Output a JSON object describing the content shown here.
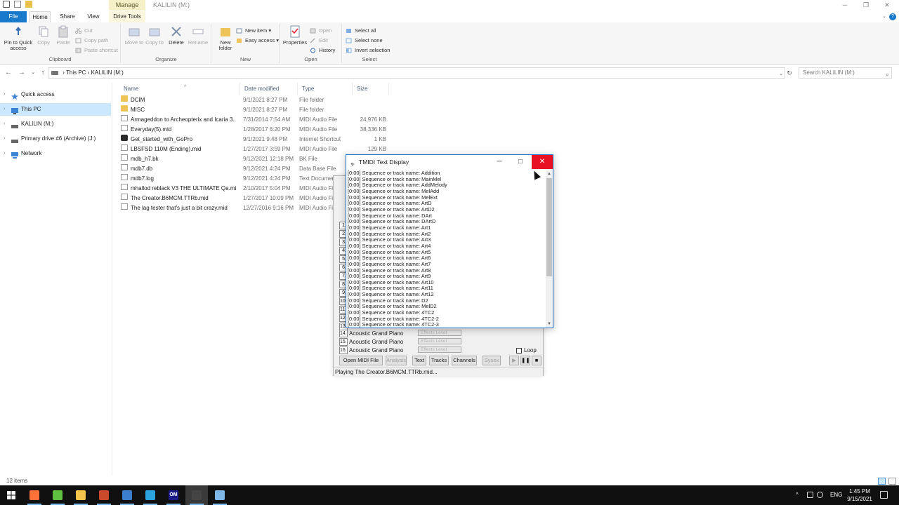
{
  "explorer": {
    "window_title": "KALILIN (M:)",
    "context_tab": "Manage",
    "tabs": [
      "File",
      "Home",
      "Share",
      "View",
      "Drive Tools"
    ],
    "ribbon": {
      "clipboard": {
        "label": "Clipboard",
        "pin": "Pin to Quick access",
        "copy": "Copy",
        "paste": "Paste",
        "cut": "Cut",
        "copy_path": "Copy path",
        "paste_shortcut": "Paste shortcut"
      },
      "organize": {
        "label": "Organize",
        "move_to": "Move to",
        "copy_to": "Copy to",
        "delete": "Delete",
        "rename": "Rename"
      },
      "new": {
        "label": "New",
        "new_folder": "New folder",
        "new_item": "New item",
        "easy_access": "Easy access"
      },
      "open": {
        "label": "Open",
        "properties": "Properties",
        "open": "Open",
        "edit": "Edit",
        "history": "History"
      },
      "select": {
        "label": "Select",
        "select_all": "Select all",
        "select_none": "Select none",
        "invert": "Invert selection"
      }
    },
    "breadcrumb": [
      "This PC",
      "KALILIN (M:)"
    ],
    "search_placeholder": "Search KALILIN (M:)",
    "nav": [
      {
        "label": "Quick access",
        "icon": "star-icon"
      },
      {
        "label": "This PC",
        "icon": "pc-icon",
        "selected": true
      },
      {
        "label": "KALILIN (M:)",
        "icon": "drive-icon"
      },
      {
        "label": "Primary drive #6 (Archive) (J:)",
        "icon": "drive-icon"
      },
      {
        "label": "Network",
        "icon": "network-icon"
      }
    ],
    "columns": {
      "name": "Name",
      "date": "Date modified",
      "type": "Type",
      "size": "Size"
    },
    "files": [
      {
        "name": "DCIM",
        "date": "9/1/2021 8:27 PM",
        "type": "File folder",
        "size": "",
        "kind": "folder"
      },
      {
        "name": "MISC",
        "date": "9/1/2021 8:27 PM",
        "type": "File folder",
        "size": "",
        "kind": "folder"
      },
      {
        "name": "Armageddon to Archeopterix and Icaria 3...",
        "date": "7/31/2014 7:54 AM",
        "type": "MIDI Audio File",
        "size": "24,976 KB",
        "kind": "file"
      },
      {
        "name": "Everyday(5).mid",
        "date": "1/28/2017 6:20 PM",
        "type": "MIDI Audio File",
        "size": "38,336 KB",
        "kind": "file"
      },
      {
        "name": "Get_started_with_GoPro",
        "date": "9/1/2021 9:48 PM",
        "type": "Internet Shortcut",
        "size": "1 KB",
        "kind": "shortcut"
      },
      {
        "name": "LBSFSD 110M (Ending).mid",
        "date": "1/27/2017 3:59 PM",
        "type": "MIDI Audio File",
        "size": "129 KB",
        "kind": "file"
      },
      {
        "name": "mdb_h7.bk",
        "date": "9/12/2021 12:18 PM",
        "type": "BK File",
        "size": "",
        "kind": "file"
      },
      {
        "name": "mdb7.db",
        "date": "9/12/2021 4:24 PM",
        "type": "Data Base File",
        "size": "",
        "kind": "file"
      },
      {
        "name": "mdb7.log",
        "date": "9/12/2021 4:24 PM",
        "type": "Text Document",
        "size": "",
        "kind": "file"
      },
      {
        "name": "mhallod reblack V3 THE ULTIMATE Qa.mid",
        "date": "2/10/2017 5:04 PM",
        "type": "MIDI Audio Fi",
        "size": "",
        "kind": "file"
      },
      {
        "name": "The Creator.B6MCM.TTRb.mid",
        "date": "1/27/2017 10:09 PM",
        "type": "MIDI Audio Fi",
        "size": "",
        "kind": "file"
      },
      {
        "name": "The lag tester that's just a bit crazy.mid",
        "date": "12/27/2016 9:16 PM",
        "type": "MIDI Audio Fi",
        "size": "",
        "kind": "file"
      }
    ],
    "status": "12 items"
  },
  "timidity": {
    "channels": [
      {
        "num": "14.",
        "instrument": "Acoustic Grand Piano",
        "effects": "Effects Level"
      },
      {
        "num": "15.",
        "instrument": "Acoustic Grand Piano",
        "effects": "Effects Level"
      },
      {
        "num": "16.",
        "instrument": "Acoustic Grand Piano",
        "effects": "Effects Level"
      }
    ],
    "hidden_channel_numbers": [
      "1.",
      "2.",
      "3.",
      "4.",
      "5.",
      "6.",
      "7.",
      "8.",
      "9.",
      "10.",
      "11.",
      "12.",
      "13."
    ],
    "loop_label": "Loop",
    "buttons": {
      "open": "Open MIDI File",
      "analysis": "Analysis",
      "text": "Text",
      "tracks": "Tracks",
      "channels": "Channels",
      "sysex": "Sysex"
    },
    "status": "Playing The Creator.B6MCM.TTRb.mid..."
  },
  "text_display": {
    "title": "TMIDI Text Display",
    "lines": [
      "[0:00] Sequence or track name: Addition",
      "[0:00] Sequence or track name: MainMel",
      "[0:00] Sequence or track name: AddMelody",
      "[0:00] Sequence or track name: MelAdd",
      "[0:00] Sequence or track name: MelExt",
      "[0:00] Sequence or track name: ArtD",
      "[0:00] Sequence or track name: ArtD2",
      "[0:00] Sequence or track name: DArt",
      "[0:00] Sequence or track name: DArtD",
      "[0:00] Sequence or track name: Art1",
      "[0:00] Sequence or track name: Art2",
      "[0:00] Sequence or track name: Art3",
      "[0:00] Sequence or track name: Art4",
      "[0:00] Sequence or track name: Art5",
      "[0:00] Sequence or track name: Art6",
      "[0:00] Sequence or track name: Art7",
      "[0:00] Sequence or track name: Art8",
      "[0:00] Sequence or track name: Art9",
      "[0:00] Sequence or track name: Art10",
      "[0:00] Sequence or track name: Art11",
      "[0:00] Sequence or track name: Art12",
      "[0:00] Sequence or track name: D2",
      "[0:00] Sequence or track name: MelD2",
      "[0:00] Sequence or track name: 4TC2",
      "[0:00] Sequence or track name: 4TC2-2",
      "[0:00] Sequence or track name: 4TC2-3"
    ]
  },
  "taskbar": {
    "language": "ENG",
    "time": "1:45 PM",
    "date": "9/15/2021",
    "apps": [
      {
        "icon": "firefox-icon",
        "color": "#ff7139"
      },
      {
        "icon": "utorrent-icon",
        "color": "#5fbf3f"
      },
      {
        "icon": "file-explorer-icon",
        "color": "#f1c34b"
      },
      {
        "icon": "app-grid-icon",
        "color": "#c84a2a"
      },
      {
        "icon": "app-window-icon",
        "color": "#3c7ecb"
      },
      {
        "icon": "telegram-icon",
        "color": "#2aa3df"
      },
      {
        "icon": "om-app-icon",
        "color": "#1b1b8a",
        "text": "OM"
      },
      {
        "icon": "timidity-icon",
        "color": "#444444"
      },
      {
        "icon": "notepad-icon",
        "color": "#7fb7e6"
      }
    ]
  }
}
